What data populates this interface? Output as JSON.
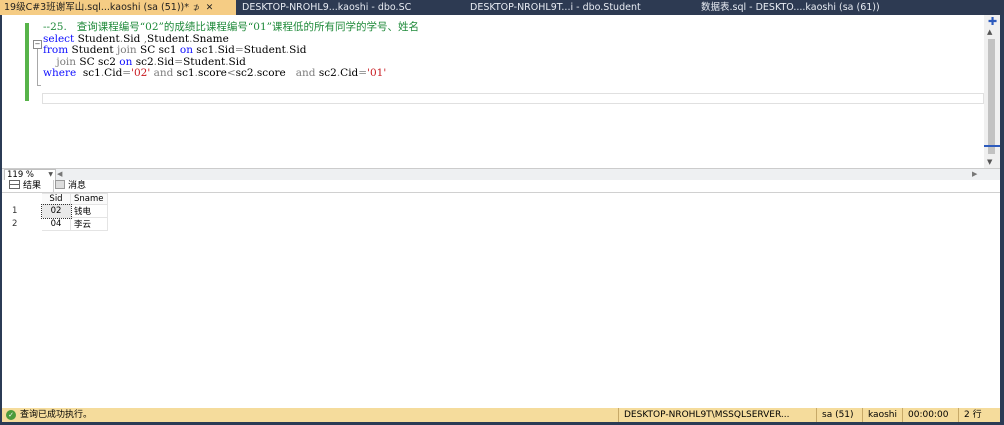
{
  "tabs": [
    {
      "label": "19级C#3班谢军山.sql...kaoshi (sa (51))*",
      "pin": "⊅",
      "close": "✕",
      "active": true
    },
    {
      "label": "DESKTOP-NROHL9...kaoshi - dbo.SC",
      "active": false
    },
    {
      "label": "DESKTOP-NROHL9T...i - dbo.Student",
      "active": false
    },
    {
      "label": "数据表.sql - DESKTO....kaoshi (sa (61))",
      "active": false
    }
  ],
  "editor": {
    "comment": "--25.   查询课程编号“02”的成绩比课程编号“01”课程低的所有同学的学号、姓名",
    "line1": {
      "kw1": "select",
      "t1": " Student",
      "g1": ".",
      "t2": "Sid ",
      "g2": ",",
      "t3": "Student",
      "g3": ".",
      "t4": "Sname"
    },
    "line2": {
      "kw1": "from",
      "t1": " Student ",
      "kw2": "join",
      "t2": " SC sc1 ",
      "kw3": "on",
      "t3": " sc1",
      "g1": ".",
      "t4": "Sid",
      "g2": "=",
      "t5": "Student",
      "g3": ".",
      "t6": "Sid"
    },
    "line3": {
      "t1": "    ",
      "kw1": "join",
      "t2": " SC sc2 ",
      "kw2": "on",
      "t3": " sc2",
      "g1": ".",
      "t4": "Sid",
      "g2": "=",
      "t5": "Student",
      "g3": ".",
      "t6": "Sid"
    },
    "line4": {
      "kw1": "where",
      "t1": "  sc1",
      "g1": ".",
      "t2": "Cid",
      "g2": "=",
      "s1": "'02'",
      "t3": " ",
      "g3": "and",
      "t4": " sc1",
      "g4": ".",
      "t5": "score",
      "g5": "<",
      "t6": "sc2",
      "g6": ".",
      "t7": "score   ",
      "g7": "and",
      "t8": " sc2",
      "g8": ".",
      "t9": "Cid",
      "g9": "=",
      "s2": "'01'"
    }
  },
  "zoom": "119 %",
  "result_tabs": {
    "results": "结果",
    "messages": "消息"
  },
  "grid": {
    "columns": [
      "Sid",
      "Sname"
    ],
    "rows": [
      {
        "n": "1",
        "Sid": "02",
        "Sname": "钱电"
      },
      {
        "n": "2",
        "Sid": "04",
        "Sname": "李云"
      }
    ]
  },
  "status": {
    "message": "查询已成功执行。",
    "server": "DESKTOP-NROHL9T\\MSSQLSERVER...",
    "user": "sa (51)",
    "db": "kaoshi",
    "time": "00:00:00",
    "rows": "2 行"
  },
  "colors": {
    "keyword": "#1010ff",
    "comment": "#1f8a3a",
    "string": "#c8191f",
    "active_tab": "#f5cc84",
    "status_bar": "#f5dc9c"
  }
}
